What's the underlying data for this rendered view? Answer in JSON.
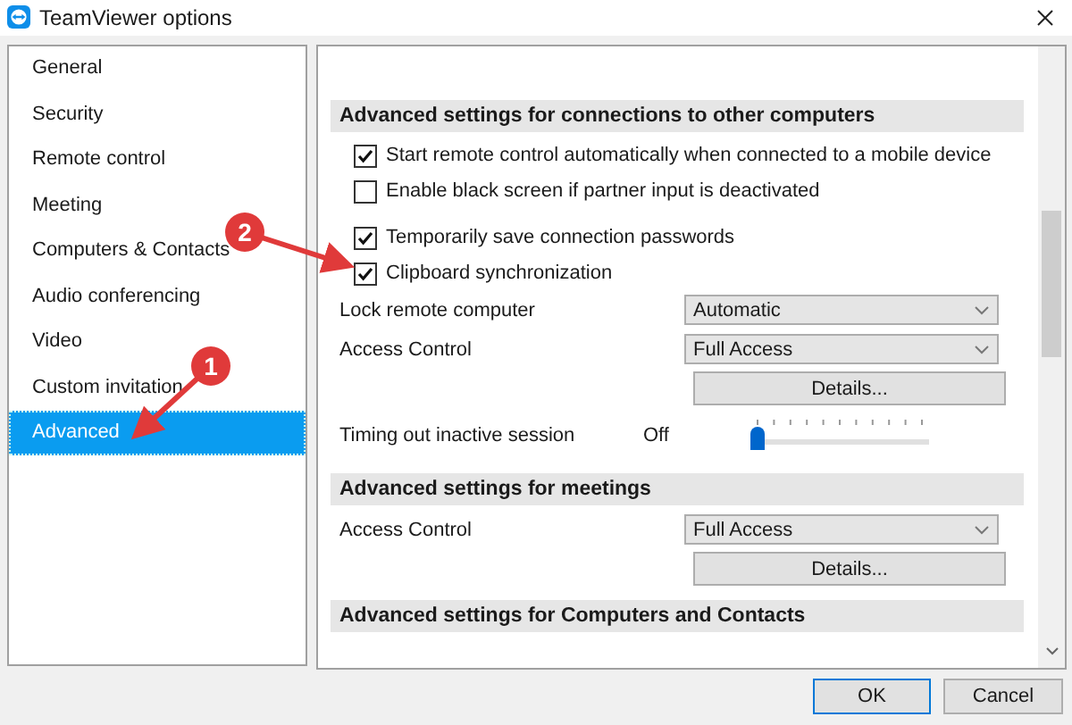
{
  "window": {
    "title": "TeamViewer options"
  },
  "sidebar": {
    "items": [
      {
        "label": "General",
        "selected": false
      },
      {
        "label": "Security",
        "selected": false
      },
      {
        "label": "Remote control",
        "selected": false
      },
      {
        "label": "Meeting",
        "selected": false
      },
      {
        "label": "Computers & Contacts",
        "selected": false
      },
      {
        "label": "Audio conferencing",
        "selected": false
      },
      {
        "label": "Video",
        "selected": false
      },
      {
        "label": "Custom invitation",
        "selected": false
      },
      {
        "label": "Advanced",
        "selected": true
      }
    ]
  },
  "sections": [
    {
      "title": "Advanced settings for connections to other computers",
      "rows": [
        {
          "kind": "checkbox",
          "label": "Start remote control automatically when connected to a mobile device",
          "checked": true
        },
        {
          "kind": "checkbox",
          "label": "Enable black screen if partner input is deactivated",
          "checked": false,
          "gap_after": true
        },
        {
          "kind": "checkbox",
          "label": "Temporarily save connection passwords",
          "checked": true
        },
        {
          "kind": "checkbox",
          "label": "Clipboard synchronization",
          "checked": true
        },
        {
          "kind": "select",
          "label": "Lock remote computer",
          "value": "Automatic"
        },
        {
          "kind": "select",
          "label": "Access Control",
          "value": "Full Access"
        },
        {
          "kind": "button",
          "label": "Details..."
        },
        {
          "kind": "slider",
          "label": "Timing out inactive session",
          "reading": "Off",
          "level": 0
        }
      ]
    },
    {
      "title": "Advanced settings for meetings",
      "rows": [
        {
          "kind": "select",
          "label": "Access Control",
          "value": "Full Access"
        },
        {
          "kind": "button",
          "label": "Details..."
        }
      ]
    },
    {
      "title": "Advanced settings for Computers and Contacts"
    }
  ],
  "annotations": [
    {
      "label": "1"
    },
    {
      "label": "2"
    }
  ],
  "buttons": [
    {
      "label": "OK",
      "default": true
    },
    {
      "label": "Cancel",
      "default": false
    }
  ]
}
